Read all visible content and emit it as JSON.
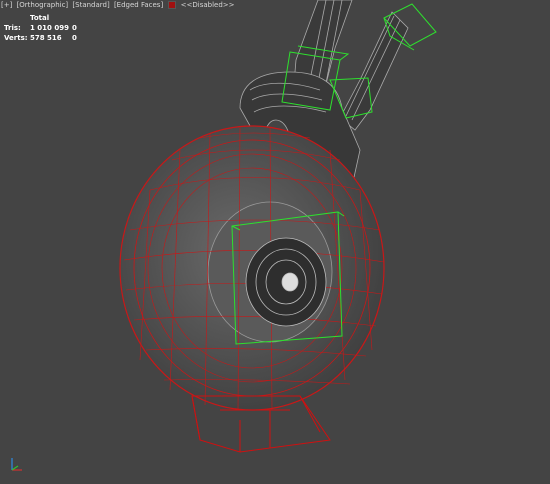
{
  "viewport_menu": {
    "plus": "[+]",
    "view": "[Orthographic]",
    "shading": "[Standard]",
    "edged": "[Edged Faces]",
    "disabled": "<<Disabled>>"
  },
  "stats": {
    "header": "Total",
    "rows": [
      {
        "label": "Tris:",
        "value": "1 010 099",
        "selected": "0"
      },
      {
        "label": "Verts:",
        "value": "578 516",
        "selected": "0"
      }
    ]
  },
  "colors": {
    "background": "#444444",
    "wire_red": "#c81818",
    "wire_gray": "#9a9a9a",
    "bbox_green": "#2ee02e",
    "select_red": "#d01010"
  },
  "icons": [
    "axis-gizmo-icon",
    "disabled-color-swatch-icon"
  ]
}
